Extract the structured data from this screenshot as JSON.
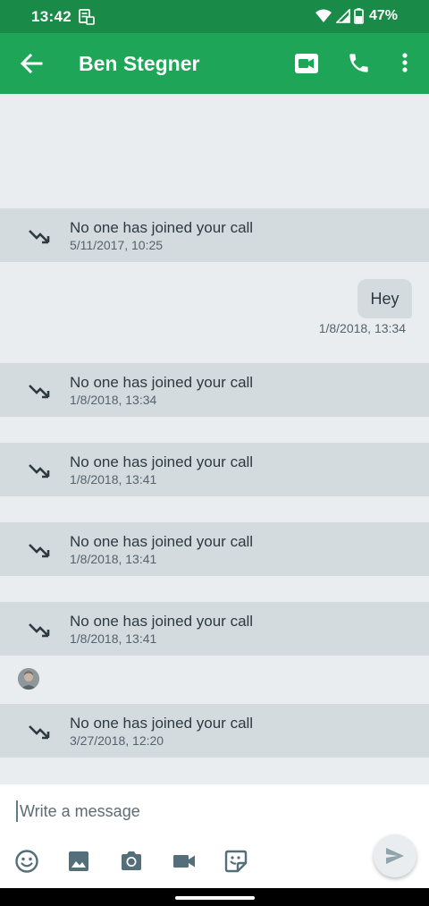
{
  "status_bar": {
    "time": "13:42",
    "battery": "47%"
  },
  "header": {
    "title": "Ben Stegner"
  },
  "conversation": {
    "calls": [
      {
        "text": "No one has joined your call",
        "timestamp": "5/11/2017, 10:25"
      },
      {
        "text": "No one has joined your call",
        "timestamp": "1/8/2018, 13:34"
      },
      {
        "text": "No one has joined your call",
        "timestamp": "1/8/2018, 13:41"
      },
      {
        "text": "No one has joined your call",
        "timestamp": "1/8/2018, 13:41"
      },
      {
        "text": "No one has joined your call",
        "timestamp": "1/8/2018, 13:41"
      },
      {
        "text": "No one has joined your call",
        "timestamp": "3/27/2018, 12:20"
      }
    ],
    "outgoing_message": {
      "text": "Hey",
      "timestamp": "1/8/2018, 13:34"
    }
  },
  "composer": {
    "placeholder": "Write a message",
    "tools": [
      "emoji-icon",
      "image-icon",
      "camera-icon",
      "video-icon",
      "sticker-icon"
    ],
    "send_icon": "send-icon"
  },
  "colors": {
    "status_bar": "#1a8a48",
    "app_bar": "#1ea557",
    "background": "#e9edf0",
    "call_row": "#d3dbdf",
    "icon_gray": "#546e7a"
  }
}
